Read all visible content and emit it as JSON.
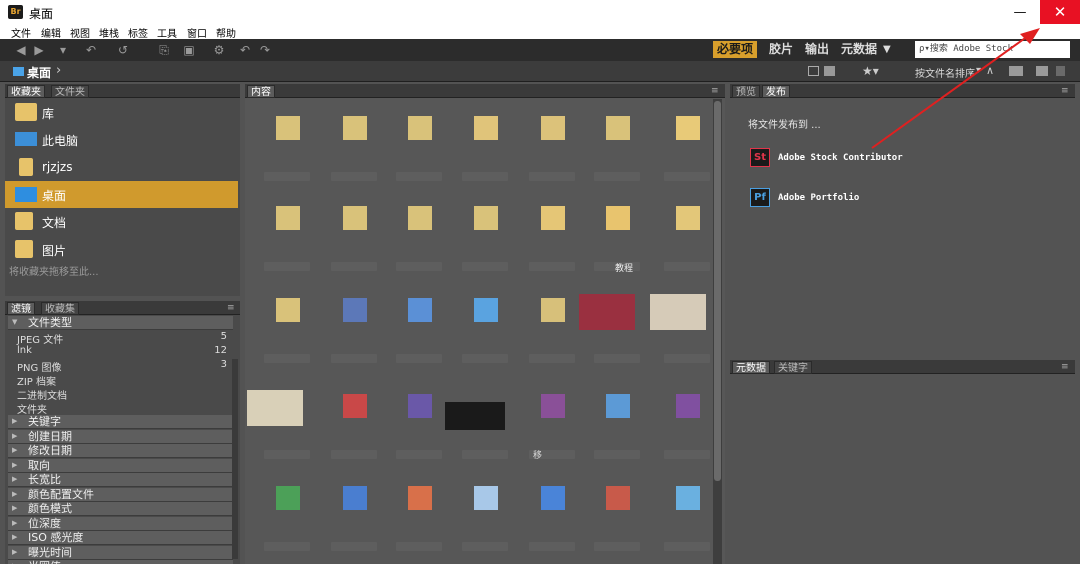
{
  "window": {
    "title": "桌面",
    "app_icon_text": "Br",
    "minimize": "—",
    "maximize": "☐",
    "close": "✕"
  },
  "menu": [
    "文件",
    "编辑",
    "视图",
    "堆栈",
    "标签",
    "工具",
    "窗口",
    "帮助"
  ],
  "workspaces": {
    "essentials": "必要项",
    "filmstrip": "胶片",
    "output": "输出",
    "metadata": "元数据",
    "more": "▼"
  },
  "search": {
    "placeholder": "ρ▾搜索 Adobe Stock"
  },
  "path": {
    "current": "桌面",
    "arrow": "›"
  },
  "sort": {
    "label": "按文件名排序",
    "arrow": "▾"
  },
  "favorites": {
    "tabs": [
      "收藏夹",
      "文件夹"
    ],
    "items": [
      {
        "label": "库",
        "icon": "library-folder-icon"
      },
      {
        "label": "此电脑",
        "icon": "computer-icon"
      },
      {
        "label": "rjzjzs",
        "icon": "folder-icon"
      },
      {
        "label": "桌面",
        "icon": "desktop-icon",
        "active": true
      },
      {
        "label": "文档",
        "icon": "documents-icon"
      },
      {
        "label": "图片",
        "icon": "pictures-icon"
      }
    ],
    "hint": "将收藏夹拖移至此..."
  },
  "filter": {
    "tabs": [
      "滤镜",
      "收藏集"
    ],
    "file_type_header": "文件类型",
    "file_types": [
      {
        "label": "JPEG 文件",
        "count": "5"
      },
      {
        "label": "lnk",
        "count": "12"
      },
      {
        "label": "PNG 图像",
        "count": "3"
      },
      {
        "label": "ZIP 档案",
        "count": ""
      },
      {
        "label": "二进制文档",
        "count": ""
      },
      {
        "label": "文件夹",
        "count": ""
      }
    ],
    "categories": [
      "关键字",
      "创建日期",
      "修改日期",
      "取向",
      "长宽比",
      "颜色配置文件",
      "颜色模式",
      "位深度",
      "ISO 感光度",
      "曝光时间",
      "光圈值"
    ]
  },
  "content": {
    "tab": "内容",
    "visible_labels": [
      "教程",
      "移"
    ]
  },
  "publish": {
    "tabs": [
      "预览",
      "发布"
    ],
    "title": "将文件发布到 ...",
    "services": [
      {
        "icon_text": "St",
        "label": "Adobe Stock Contributor",
        "color": "#e0354a"
      },
      {
        "icon_text": "Pf",
        "label": "Adobe Portfolio",
        "color": "#4a9fe0"
      }
    ]
  },
  "metadata": {
    "tabs": [
      "元数据",
      "关键字"
    ]
  },
  "colors": {
    "accent": "#d89f2c",
    "annotation": "#e02020",
    "close": "#e81123"
  }
}
